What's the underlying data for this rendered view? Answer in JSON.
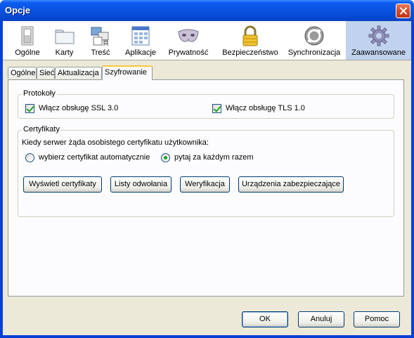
{
  "window": {
    "title": "Opcje"
  },
  "toolbar": {
    "items": [
      {
        "label": "Ogólne",
        "icon": "general-icon"
      },
      {
        "label": "Karty",
        "icon": "tabs-icon"
      },
      {
        "label": "Treść",
        "icon": "content-icon"
      },
      {
        "label": "Aplikacje",
        "icon": "applications-icon"
      },
      {
        "label": "Prywatność",
        "icon": "privacy-mask-icon"
      },
      {
        "label": "Bezpieczeństwo",
        "icon": "padlock-icon"
      },
      {
        "label": "Synchronizacja",
        "icon": "sync-icon"
      },
      {
        "label": "Zaawansowane",
        "icon": "gear-icon"
      }
    ],
    "selected": "Zaawansowane"
  },
  "subtabs": {
    "items": [
      "Ogólne",
      "Sieć",
      "Aktualizacja",
      "Szyfrowanie"
    ],
    "active": "Szyfrowanie"
  },
  "protocols": {
    "legend": "Protokoły",
    "ssl_label": "Włącz obsługę SSL 3.0",
    "ssl_checked": true,
    "tls_label": "Włącz obsługę TLS 1.0",
    "tls_checked": true
  },
  "certificates": {
    "legend": "Certyfikaty",
    "prompt": "Kiedy serwer żąda osobistego certyfikatu użytkownika:",
    "option_auto": "wybierz certyfikat automatycznie",
    "option_ask": "pytaj za każdym razem",
    "selected_option": "pytaj za każdym razem",
    "buttons": {
      "view": "Wyświetl certyfikaty",
      "revocation": "Listy odwołania",
      "verification": "Weryfikacja",
      "devices": "Urządzenia zabezpieczające"
    }
  },
  "footer": {
    "ok": "OK",
    "cancel": "Anuluj",
    "help": "Pomoc"
  },
  "colors": {
    "titlebar": "#0854e3",
    "selected_tab_bg": "#c1d2ee",
    "dialog_bg": "#ece9d8",
    "accent_tab": "#ffc83c",
    "check_mark": "#21a121"
  }
}
